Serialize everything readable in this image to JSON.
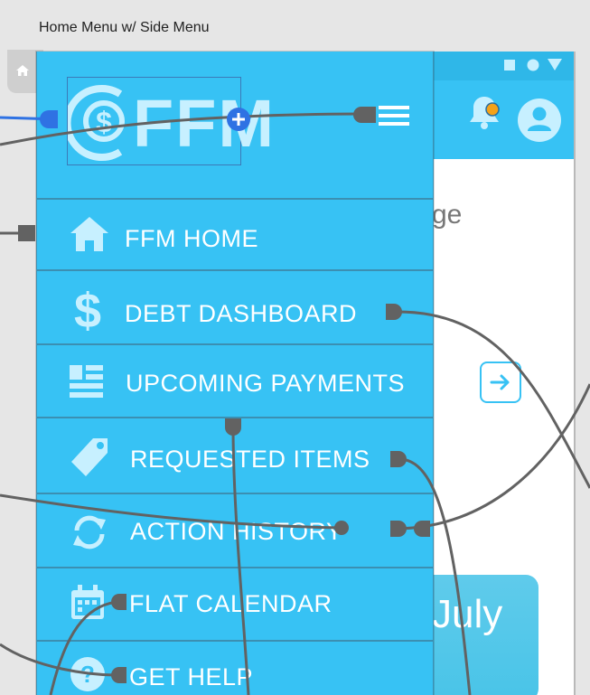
{
  "canvas": {
    "title": "Home Menu w/ Side Menu"
  },
  "drawer": {
    "logo_text": "FFM",
    "menu": [
      {
        "label": "FFM HOME",
        "icon": "home-icon"
      },
      {
        "label": "DEBT DASHBOARD",
        "icon": "dollar-icon"
      },
      {
        "label": "UPCOMING PAYMENTS",
        "icon": "list-icon"
      },
      {
        "label": "REQUESTED ITEMS",
        "icon": "tag-icon"
      },
      {
        "label": "ACTION HISTORY",
        "icon": "refresh-icon"
      },
      {
        "label": "FLAT CALENDAR",
        "icon": "calendar-icon"
      },
      {
        "label": "GET HELP",
        "icon": "help-icon"
      }
    ]
  },
  "background_screen": {
    "heading_fragment": "ge",
    "month_label": "July"
  },
  "colors": {
    "drawer": "#37c2f4",
    "divider": "#3b8fb2",
    "wire": "#626262",
    "selected_wire": "#2f72e3",
    "icon": "#c7f0ff"
  }
}
